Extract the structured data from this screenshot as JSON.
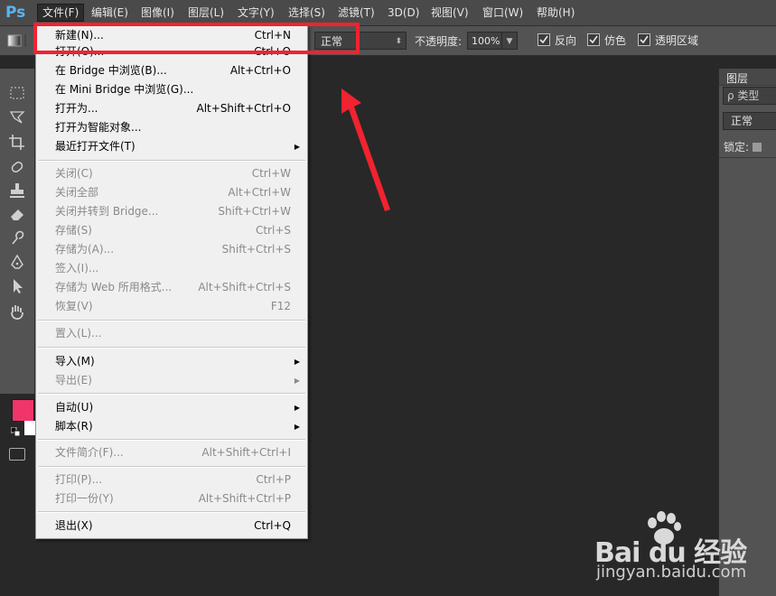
{
  "app": {
    "logo": "Ps"
  },
  "menubar": {
    "items": [
      {
        "label": "文件(F)",
        "active": true
      },
      {
        "label": "编辑(E)"
      },
      {
        "label": "图像(I)"
      },
      {
        "label": "图层(L)"
      },
      {
        "label": "文字(Y)"
      },
      {
        "label": "选择(S)"
      },
      {
        "label": "滤镜(T)"
      },
      {
        "label": "3D(D)"
      },
      {
        "label": "视图(V)"
      },
      {
        "label": "窗口(W)"
      },
      {
        "label": "帮助(H)"
      }
    ]
  },
  "options": {
    "blend_mode": "正常",
    "opacity_label": "不透明度:",
    "opacity_value": "100%",
    "checkboxes": [
      {
        "label": "反向",
        "checked": true
      },
      {
        "label": "仿色",
        "checked": true
      },
      {
        "label": "透明区域",
        "checked": true
      }
    ]
  },
  "file_menu": {
    "items": [
      {
        "label": "新建(N)...",
        "shortcut": "Ctrl+N",
        "enabled": true
      },
      {
        "label": "打开(O)...",
        "shortcut": "Ctrl+O",
        "enabled": true
      },
      {
        "label": "在 Bridge 中浏览(B)...",
        "shortcut": "Alt+Ctrl+O",
        "enabled": true
      },
      {
        "label": "在 Mini Bridge 中浏览(G)...",
        "shortcut": "",
        "enabled": true
      },
      {
        "label": "打开为...",
        "shortcut": "Alt+Shift+Ctrl+O",
        "enabled": true
      },
      {
        "label": "打开为智能对象...",
        "shortcut": "",
        "enabled": true
      },
      {
        "label": "最近打开文件(T)",
        "shortcut": "",
        "enabled": true,
        "submenu": true
      },
      {
        "label": "关闭(C)",
        "shortcut": "Ctrl+W",
        "enabled": false
      },
      {
        "label": "关闭全部",
        "shortcut": "Alt+Ctrl+W",
        "enabled": false
      },
      {
        "label": "关闭并转到 Bridge...",
        "shortcut": "Shift+Ctrl+W",
        "enabled": false
      },
      {
        "label": "存储(S)",
        "shortcut": "Ctrl+S",
        "enabled": false
      },
      {
        "label": "存储为(A)...",
        "shortcut": "Shift+Ctrl+S",
        "enabled": false
      },
      {
        "label": "签入(I)...",
        "shortcut": "",
        "enabled": false
      },
      {
        "label": "存储为 Web 所用格式...",
        "shortcut": "Alt+Shift+Ctrl+S",
        "enabled": false
      },
      {
        "label": "恢复(V)",
        "shortcut": "F12",
        "enabled": false
      },
      {
        "label": "置入(L)...",
        "shortcut": "",
        "enabled": false
      },
      {
        "label": "导入(M)",
        "shortcut": "",
        "enabled": true,
        "submenu": true
      },
      {
        "label": "导出(E)",
        "shortcut": "",
        "enabled": false,
        "submenu": true
      },
      {
        "label": "自动(U)",
        "shortcut": "",
        "enabled": true,
        "submenu": true
      },
      {
        "label": "脚本(R)",
        "shortcut": "",
        "enabled": true,
        "submenu": true
      },
      {
        "label": "文件简介(F)...",
        "shortcut": "Alt+Shift+Ctrl+I",
        "enabled": false
      },
      {
        "label": "打印(P)...",
        "shortcut": "Ctrl+P",
        "enabled": false
      },
      {
        "label": "打印一份(Y)",
        "shortcut": "Alt+Shift+Ctrl+P",
        "enabled": false
      },
      {
        "label": "退出(X)",
        "shortcut": "Ctrl+Q",
        "enabled": true
      }
    ]
  },
  "layers_panel": {
    "tab_label": "图层",
    "filter_label": "ρ 类型",
    "blend_mode": "正常",
    "lock_label": "锁定:"
  },
  "colors": {
    "foreground": "#f0356a",
    "background": "#ffffff",
    "highlight": "#f0232f"
  },
  "watermark": {
    "brand": "Bai  du 经验",
    "url": "jingyan.baidu.com"
  }
}
